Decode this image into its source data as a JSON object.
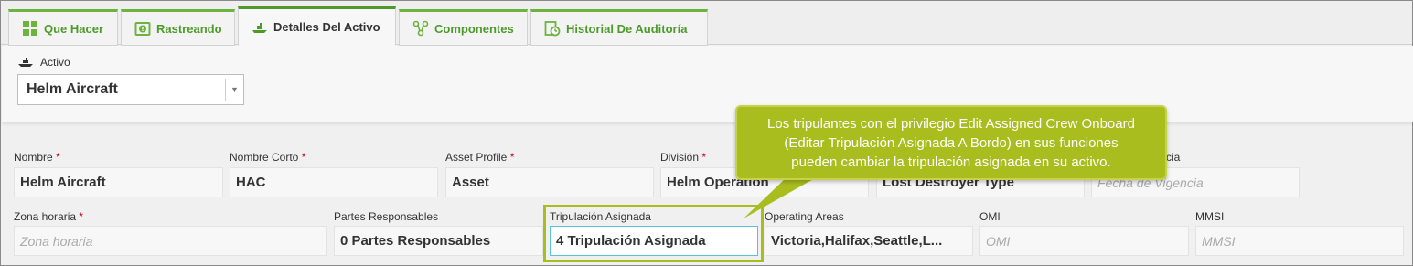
{
  "tabs": [
    {
      "label": "Que Hacer",
      "icon": "grid-icon"
    },
    {
      "label": "Rastreando",
      "icon": "tracking-alert-icon"
    },
    {
      "label": "Detalles Del Activo",
      "icon": "vessel-icon",
      "active": true
    },
    {
      "label": "Componentes",
      "icon": "components-icon"
    },
    {
      "label": "Historial De Auditoría",
      "icon": "audit-history-icon"
    }
  ],
  "asset": {
    "label": "Activo",
    "selected": "Helm Aircraft"
  },
  "fields": {
    "nombre": {
      "label": "Nombre",
      "value": "Helm Aircraft"
    },
    "nombre_corto": {
      "label": "Nombre Corto",
      "value": "HAC"
    },
    "asset_profile": {
      "label": "Asset Profile",
      "value": "Asset"
    },
    "division": {
      "label": "División",
      "value": "Helm Operation"
    },
    "tipo": {
      "value": "Lost Destroyer Type"
    },
    "vigencia": {
      "label_fragment": "cia",
      "placeholder": "Fecha de Vigencia"
    },
    "zona_horaria": {
      "label": "Zona horaria",
      "placeholder": "Zona horaria"
    },
    "partes": {
      "label": "Partes Responsables",
      "value": "0 Partes Responsables"
    },
    "tripulacion": {
      "label": "Tripulación Asignada",
      "value": "4 Tripulación Asignada"
    },
    "operating_areas": {
      "label": "Operating Areas",
      "value": "Victoria,Halifax,Seattle,L..."
    },
    "omi": {
      "label": "OMI",
      "placeholder": "OMI"
    },
    "mmsi": {
      "label": "MMSI",
      "placeholder": "MMSI"
    }
  },
  "callout": {
    "line1": "Los tripulantes con el privilegio Edit Assigned Crew Onboard",
    "line2": "(Editar Tripulación Asignada A Bordo) en sus funciones",
    "line3": "pueden cambiar la tripulación asignada en su activo."
  },
  "colors": {
    "tab_green": "#4d9a2a",
    "callout": "#a9bd1f",
    "required": "#d0021b",
    "focus": "#5bc0de"
  }
}
